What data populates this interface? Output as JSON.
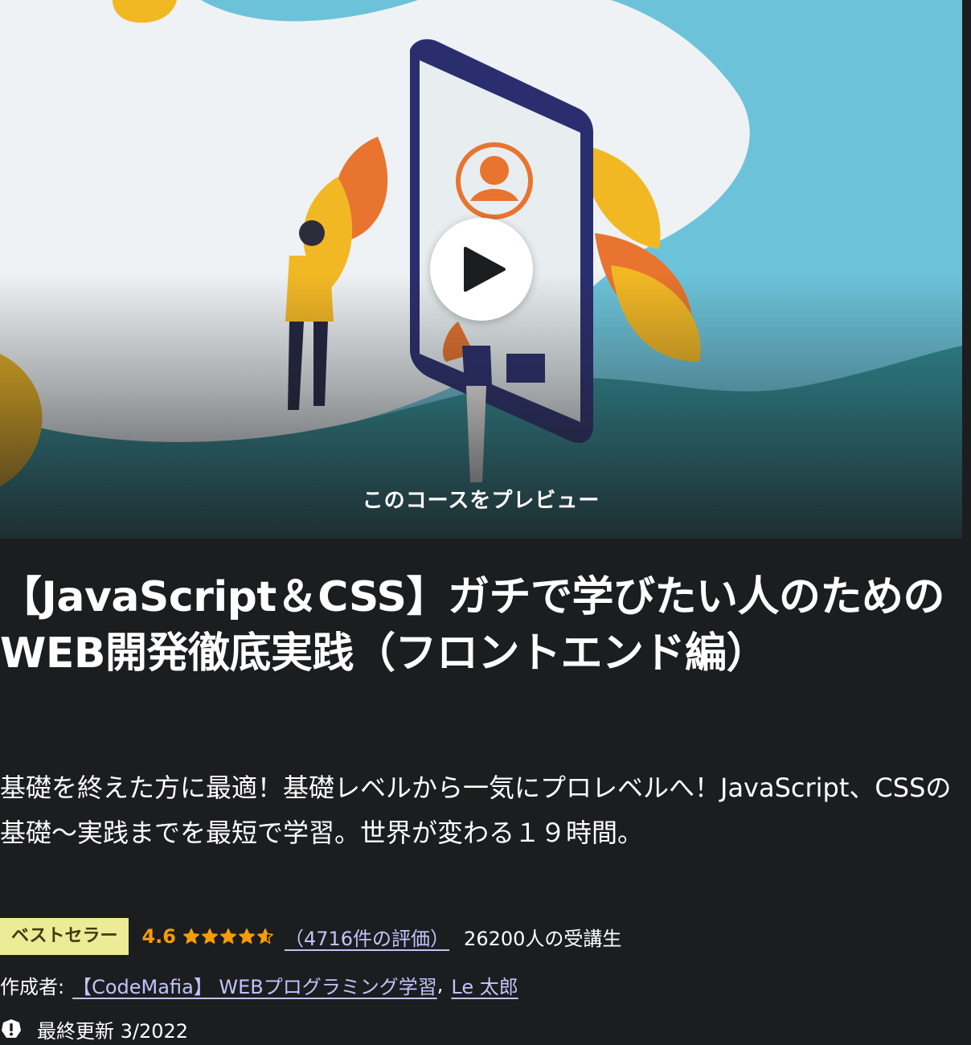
{
  "preview": {
    "label": "このコースをプレビュー",
    "play_icon": "play-icon"
  },
  "course": {
    "title": "【JavaScript＆CSS】ガチで学びたい人のためのWEB開発徹底実践（フロントエンド編）",
    "subtitle": "基礎を終えた方に最適！基礎レベルから一気にプロレベルへ！JavaScript、CSSの基礎〜実践までを最短で学習。世界が変わる１９時間。"
  },
  "stats": {
    "badge": "ベストセラー",
    "rating": "4.6",
    "rating_value": 4.6,
    "rating_max": 5,
    "rating_count": "（4716件の評価）",
    "students": "26200人の受講生"
  },
  "author": {
    "prefix": "作成者:",
    "names": [
      "【CodeMafia】 WEBプログラミング学習",
      "Le 太郎"
    ],
    "separator": ","
  },
  "updated": {
    "text": "最終更新 3/2022",
    "icon": "alert-icon"
  },
  "colors": {
    "background": "#1c1d1f",
    "badge_bg": "#eceb98",
    "badge_text": "#3d3c0a",
    "rating": "#f69c08",
    "link": "#c0c4fc"
  }
}
